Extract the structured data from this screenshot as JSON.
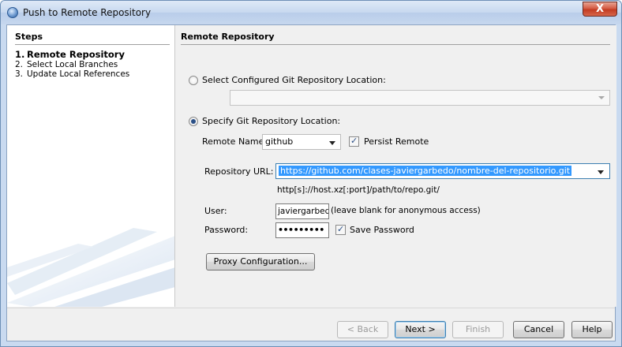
{
  "window": {
    "title": "Push to Remote Repository",
    "close_label": "X"
  },
  "steps": {
    "title": "Steps",
    "items": [
      {
        "num": "1.",
        "label": "Remote Repository",
        "active": true
      },
      {
        "num": "2.",
        "label": "Select Local Branches",
        "active": false
      },
      {
        "num": "3.",
        "label": "Update Local References",
        "active": false
      }
    ]
  },
  "panel": {
    "title": "Remote Repository",
    "configured_option": {
      "label": "Select Configured Git Repository Location:",
      "selected": false,
      "value": ""
    },
    "specify_option": {
      "label": "Specify Git Repository Location:",
      "selected": true
    },
    "remote_name": {
      "label": "Remote Name:",
      "value": "github"
    },
    "persist_remote": {
      "label": "Persist Remote",
      "checked": true
    },
    "repository_url": {
      "label": "Repository URL:",
      "value": "https://github.com/clases-javiergarbedo/nombre-del-repositorio.git",
      "hint": "http[s]://host.xz[:port]/path/to/repo.git/"
    },
    "user": {
      "label": "User:",
      "value": "javiergarbedo",
      "hint": "(leave blank for anonymous access)"
    },
    "password": {
      "label": "Password:",
      "value": "•••••••••"
    },
    "save_password": {
      "label": "Save Password",
      "checked": true
    },
    "proxy_button": "Proxy Configuration..."
  },
  "footer": {
    "back": "< Back",
    "next": "Next >",
    "finish": "Finish",
    "cancel": "Cancel",
    "help": "Help"
  }
}
